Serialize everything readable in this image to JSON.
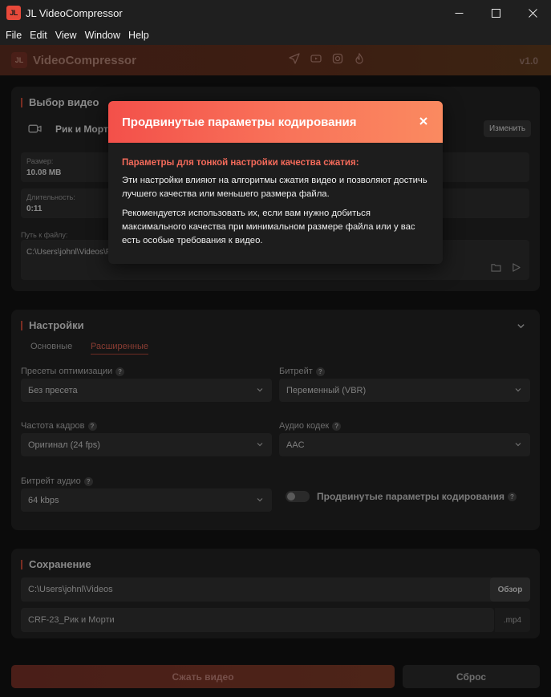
{
  "window": {
    "logo": "JL",
    "title": "JL VideoCompressor"
  },
  "menu": [
    "File",
    "Edit",
    "View",
    "Window",
    "Help"
  ],
  "header": {
    "logo": "JL",
    "title": "VideoCompressor",
    "icons": [
      "send-icon",
      "youtube-icon",
      "instagram-icon",
      "fire-icon"
    ],
    "version": "v1.0"
  },
  "video": {
    "section_title": "Выбор видео",
    "file_name": "Рик и Морти",
    "change_button": "Изменить",
    "size_label": "Размер:",
    "size_value": "10.08 MB",
    "duration_label": "Длительность:",
    "duration_value": "0:11",
    "path_label": "Путь к файлу:",
    "path_value": "C:\\Users\\johnl\\Videos\\Р"
  },
  "settings": {
    "section_title": "Настройки",
    "tabs": [
      "Основные",
      "Расширенные"
    ],
    "active_tab": 1,
    "presets_label": "Пресеты оптимизации",
    "presets_value": "Без пресета",
    "bitrate_label": "Битрейт",
    "bitrate_value": "Переменный (VBR)",
    "fps_label": "Частота кадров",
    "fps_value": "Оригинал (24 fps)",
    "audio_codec_label": "Аудио кодек",
    "audio_codec_value": "AAC",
    "audio_bitrate_label": "Битрейт аудио",
    "audio_bitrate_value": "64 kbps",
    "advanced_toggle_label": "Продвинутые параметры кодирования",
    "advanced_toggle_on": false,
    "help": "?"
  },
  "save": {
    "section_title": "Сохранение",
    "folder_value": "C:\\Users\\johnl\\Videos",
    "browse_button": "Обзор",
    "filename_value": "CRF-23_Рик и Морти",
    "extension": ".mp4"
  },
  "actions": {
    "compress_button": "Сжать видео",
    "reset_button": "Сброс"
  },
  "modal": {
    "title": "Продвинутые параметры кодирования",
    "subtitle": "Параметры для тонкой настройки качества сжатия:",
    "paragraph1": "Эти настройки влияют на алгоритмы сжатия видео и позволяют достичь лучшего качества или меньшего размера файла.",
    "paragraph2": "Рекомендуется использовать их, если вам нужно добиться максимального качества при минимальном размере файла или у вас есть особые требования к видео."
  },
  "colors": {
    "accent": "#f3504a",
    "accent_end": "#fa8a60",
    "background": "#0c0c0c",
    "modal_bg": "#1d1d1d"
  }
}
